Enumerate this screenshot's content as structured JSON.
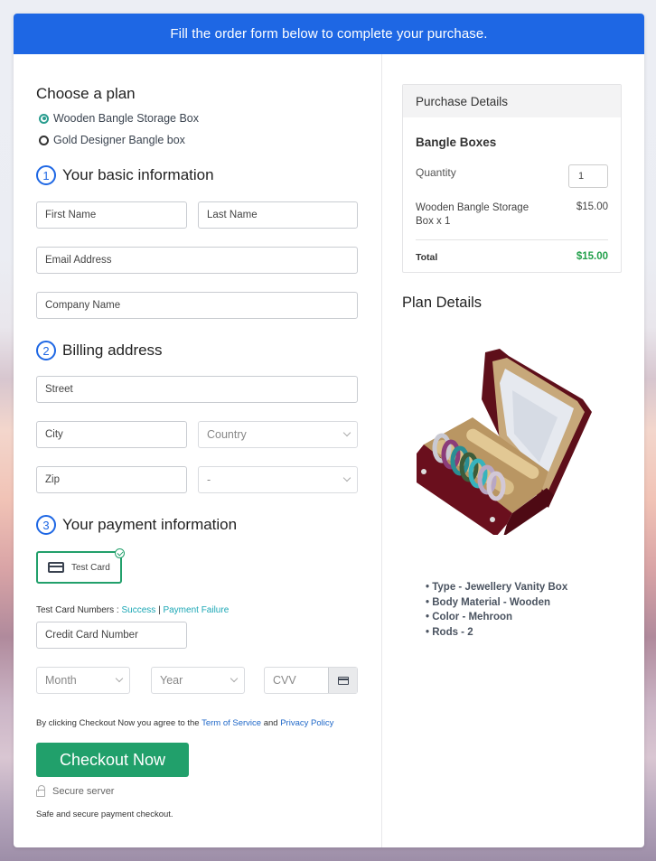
{
  "banner": {
    "text": "Fill the order form below to complete your purchase.",
    "color": "#1e67e4"
  },
  "plan": {
    "heading": "Choose a plan",
    "options": [
      {
        "label": "Wooden Bangle Storage Box",
        "selected": true
      },
      {
        "label": "Gold Designer Bangle box",
        "selected": false
      }
    ]
  },
  "basic_info": {
    "number": "1",
    "heading": "Your basic information",
    "first_name_placeholder": "First Name",
    "last_name_placeholder": "Last Name",
    "email_placeholder": "Email Address",
    "company_placeholder": "Company Name"
  },
  "billing": {
    "number": "2",
    "heading": "Billing address",
    "street_placeholder": "Street",
    "city_placeholder": "City",
    "country_selected": "Country",
    "zip_placeholder": "Zip",
    "state_selected": "-"
  },
  "payment": {
    "number": "3",
    "heading": "Your payment information",
    "method_label": "Test Card",
    "test_numbers_label": "Test Card Numbers :",
    "success_link": "Success",
    "separator": "|",
    "failure_link": "Payment Failure",
    "card_number_placeholder": "Credit Card Number",
    "month_selected": "Month",
    "year_selected": "Year",
    "cvv_placeholder": "CVV"
  },
  "terms": {
    "prefix": "By clicking Checkout Now you agree to the",
    "tos_link": "Term of Service",
    "and": "and",
    "privacy_link": "Privacy Policy"
  },
  "checkout": {
    "button_label": "Checkout Now",
    "button_color": "#21a06b",
    "secure_label": "Secure server",
    "safe_text": "Safe and secure payment checkout."
  },
  "purchase_details": {
    "heading": "Purchase Details",
    "product_group": "Bangle Boxes",
    "quantity_label": "Quantity",
    "quantity_value": "1",
    "line_item_line1": "Wooden Bangle Storage",
    "line_item_line2": "Box x 1",
    "line_item_price": "$15.00",
    "total_label": "Total",
    "total_value": "$15.00",
    "total_color": "#22a04b"
  },
  "plan_details": {
    "heading": "Plan Details",
    "image_alt": "Maroon bangle storage box with mirror lid and rods holding bangles",
    "features": [
      "Type - Jewellery Vanity Box",
      "Body Material - Wooden",
      "Color - Mehroon",
      "Rods - 2"
    ]
  }
}
